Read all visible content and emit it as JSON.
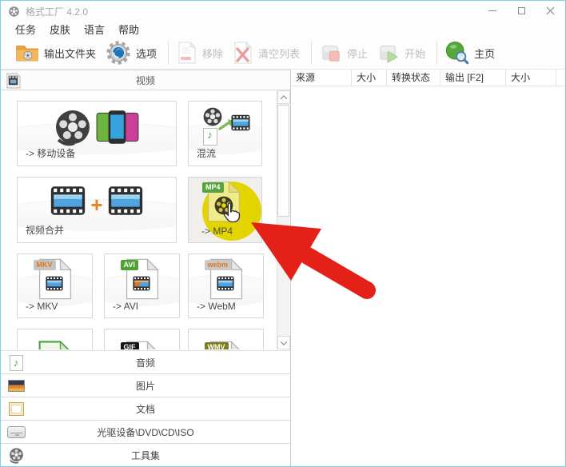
{
  "window": {
    "title": "格式工厂 4.2.0"
  },
  "menu": {
    "items": [
      {
        "label": "任务"
      },
      {
        "label": "皮肤"
      },
      {
        "label": "语言"
      },
      {
        "label": "帮助"
      }
    ]
  },
  "toolbar": {
    "buttons": [
      {
        "label": "输出文件夹",
        "enabled": true
      },
      {
        "label": "选项",
        "enabled": true
      },
      {
        "label": "移除",
        "enabled": false
      },
      {
        "label": "清空列表",
        "enabled": false
      },
      {
        "label": "停止",
        "enabled": false
      },
      {
        "label": "开始",
        "enabled": false
      },
      {
        "label": "主页",
        "enabled": true
      }
    ]
  },
  "left_panel": {
    "video_header": "视频",
    "tiles": {
      "mobile": {
        "label": "-> 移动设备"
      },
      "mux": {
        "label": "混流"
      },
      "merge": {
        "label": "视频合并"
      },
      "mp4": {
        "label": "-> MP4",
        "badge": "MP4"
      },
      "mkv": {
        "label": "-> MKV",
        "badge": "MKV"
      },
      "avi": {
        "label": "-> AVI",
        "badge": "AVI"
      },
      "webm": {
        "label": "-> WebM",
        "badge": "webm"
      },
      "gif": {
        "badge": "GIF"
      },
      "wmv": {
        "badge": "WMV"
      }
    },
    "accordion": [
      {
        "label": "音频"
      },
      {
        "label": "图片"
      },
      {
        "label": "文档"
      },
      {
        "label": "光驱设备\\DVD\\CD\\ISO"
      },
      {
        "label": "工具集"
      }
    ]
  },
  "file_table": {
    "columns": [
      {
        "label": "来源"
      },
      {
        "label": "大小"
      },
      {
        "label": "转换状态"
      },
      {
        "label": "输出 [F2]"
      },
      {
        "label": "大小"
      }
    ]
  },
  "icons": {
    "note": "♪",
    "plus": "+"
  },
  "colors": {
    "highlight_yellow": "#e3d400",
    "arrow_red": "#e32119",
    "accent_blue": "#1b75bb"
  }
}
